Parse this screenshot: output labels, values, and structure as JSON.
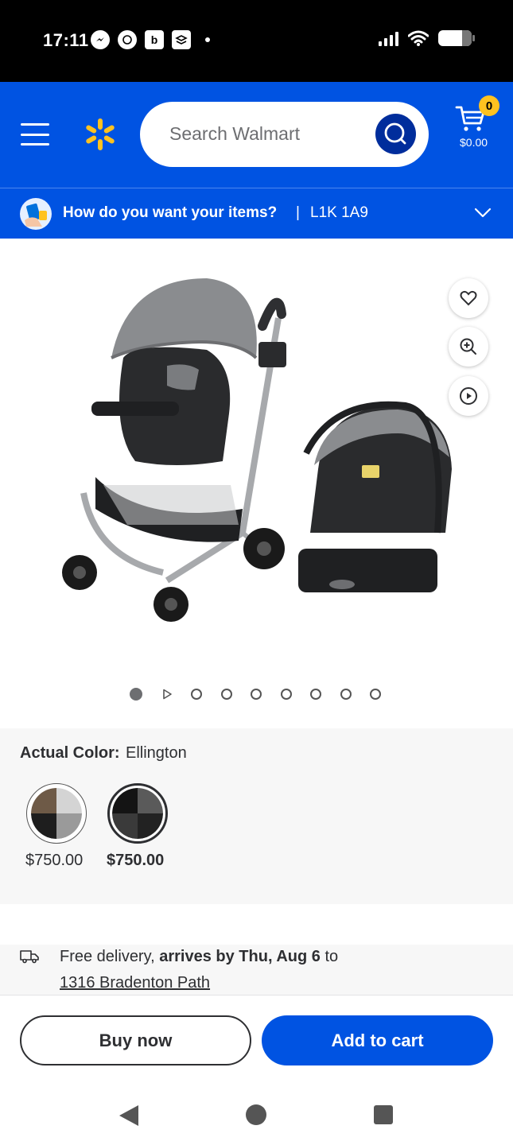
{
  "status_bar": {
    "time": "17:11",
    "left_icons": [
      "messenger-icon",
      "whatsapp-icon",
      "b-app-icon",
      "stack-app-icon"
    ],
    "right_icons": [
      "signal-icon",
      "wifi-icon",
      "battery-icon"
    ]
  },
  "header": {
    "search_placeholder": "Search Walmart",
    "cart_count": "0",
    "cart_amount": "$0.00",
    "brand_color": "#0053e2",
    "spark_color": "#ffc220"
  },
  "delivery": {
    "question": "How do you want your items?",
    "separator": "|",
    "postal_code": "L1K 1A9"
  },
  "gallery": {
    "image_alt": "Graco stroller and infant car seat travel system",
    "action_icons": [
      "heart-icon",
      "zoom-in-icon",
      "play-icon"
    ],
    "dots_total": 9,
    "active_index": 0
  },
  "variant": {
    "label": "Actual Color:",
    "value": "Ellington",
    "options": [
      {
        "name": "swatch-option-1",
        "price": "$750.00",
        "selected": false
      },
      {
        "name": "swatch-option-2",
        "price": "$750.00",
        "selected": true
      }
    ]
  },
  "fulfillment": {
    "prefix": "Free delivery, ",
    "highlight": "arrives by Thu, Aug 6",
    "suffix": " to",
    "address": "1316 Bradenton Path"
  },
  "actions": {
    "buy_now": "Buy now",
    "add_to_cart": "Add to cart"
  }
}
